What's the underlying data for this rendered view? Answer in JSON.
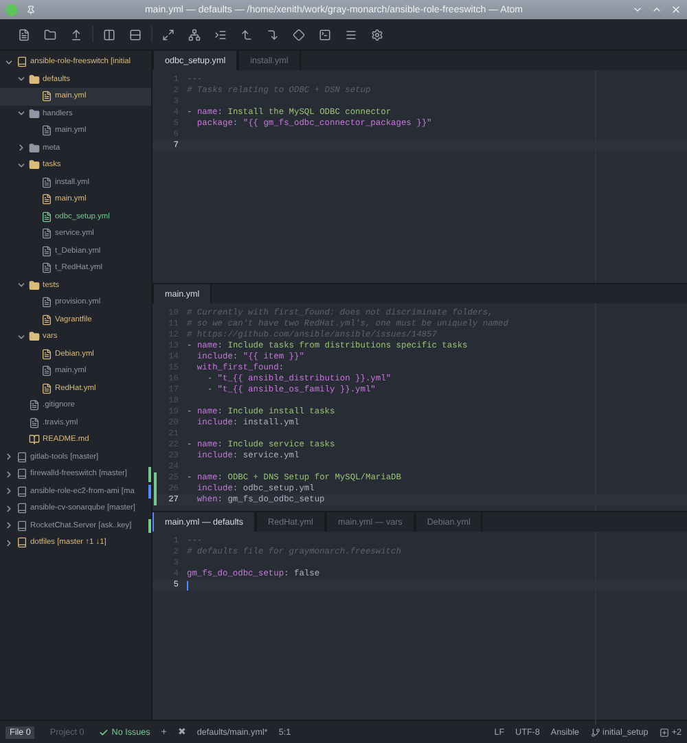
{
  "window": {
    "title": "main.yml — defaults — /home/xenith/work/gray-monarch/ansible-role-freeswitch — Atom"
  },
  "sidebar": {
    "tree": [
      {
        "kind": "repo",
        "label": "ansible-role-freeswitch [initial",
        "modified": true,
        "untracked": false,
        "expanded": true,
        "selected": false,
        "children": [
          {
            "kind": "folder",
            "label": "defaults",
            "modified": true,
            "untracked": false,
            "expanded": true,
            "selected": false,
            "children": [
              {
                "kind": "file",
                "label": "main.yml",
                "modified": true,
                "untracked": false,
                "selected": true
              }
            ]
          },
          {
            "kind": "folder",
            "label": "handlers",
            "modified": false,
            "untracked": false,
            "expanded": true,
            "selected": false,
            "children": [
              {
                "kind": "file",
                "label": "main.yml",
                "modified": false,
                "untracked": false,
                "selected": false
              }
            ]
          },
          {
            "kind": "folder",
            "label": "meta",
            "modified": false,
            "untracked": false,
            "expanded": false,
            "selected": false
          },
          {
            "kind": "folder",
            "label": "tasks",
            "modified": true,
            "untracked": false,
            "expanded": true,
            "selected": false,
            "children": [
              {
                "kind": "file",
                "label": "install.yml",
                "modified": false,
                "untracked": false,
                "selected": false
              },
              {
                "kind": "file",
                "label": "main.yml",
                "modified": true,
                "untracked": false,
                "selected": false
              },
              {
                "kind": "file",
                "label": "odbc_setup.yml",
                "modified": false,
                "untracked": true,
                "selected": false
              },
              {
                "kind": "file",
                "label": "service.yml",
                "modified": false,
                "untracked": false,
                "selected": false
              },
              {
                "kind": "file",
                "label": "t_Debian.yml",
                "modified": false,
                "untracked": false,
                "selected": false
              },
              {
                "kind": "file",
                "label": "t_RedHat.yml",
                "modified": false,
                "untracked": false,
                "selected": false
              }
            ]
          },
          {
            "kind": "folder",
            "label": "tests",
            "modified": true,
            "untracked": false,
            "expanded": true,
            "selected": false,
            "children": [
              {
                "kind": "file",
                "label": "provision.yml",
                "modified": false,
                "untracked": false,
                "selected": false
              },
              {
                "kind": "file",
                "label": "Vagrantfile",
                "modified": true,
                "untracked": false,
                "selected": false
              }
            ]
          },
          {
            "kind": "folder",
            "label": "vars",
            "modified": true,
            "untracked": false,
            "expanded": true,
            "selected": false,
            "children": [
              {
                "kind": "file",
                "label": "Debian.yml",
                "modified": true,
                "untracked": false,
                "selected": false
              },
              {
                "kind": "file",
                "label": "main.yml",
                "modified": false,
                "untracked": false,
                "selected": false
              },
              {
                "kind": "file",
                "label": "RedHat.yml",
                "modified": true,
                "untracked": false,
                "selected": false
              }
            ]
          },
          {
            "kind": "file",
            "label": ".gitignore",
            "modified": false,
            "untracked": false,
            "selected": false
          },
          {
            "kind": "file",
            "label": ".travis.yml",
            "modified": false,
            "untracked": false,
            "selected": false
          },
          {
            "kind": "readme",
            "label": "README.md",
            "modified": true,
            "untracked": false,
            "selected": false
          }
        ]
      },
      {
        "kind": "repo",
        "label": "gitlab-tools [master]",
        "modified": false,
        "untracked": false,
        "expanded": false,
        "selected": false
      },
      {
        "kind": "repo",
        "label": "firewalld-freeswitch [master]",
        "modified": false,
        "untracked": false,
        "expanded": false,
        "selected": false,
        "color": "#73c990"
      },
      {
        "kind": "repo",
        "label": "ansible-role-ec2-from-ami [ma",
        "modified": false,
        "untracked": false,
        "expanded": false,
        "selected": false,
        "color": "#568af2"
      },
      {
        "kind": "repo",
        "label": "ansible-cv-sonarqube [master]",
        "modified": false,
        "untracked": false,
        "expanded": false,
        "selected": false
      },
      {
        "kind": "repo",
        "label": "RocketChat.Server [ask..key]",
        "modified": false,
        "untracked": false,
        "expanded": false,
        "selected": false,
        "color": "#73c990"
      },
      {
        "kind": "repo",
        "label": "dotfiles [master ↑1 ↓1]",
        "modified": true,
        "untracked": false,
        "expanded": false,
        "selected": false
      }
    ]
  },
  "panes": [
    {
      "focused": false,
      "tabs": [
        {
          "label": "odbc_setup.yml",
          "selected": true
        },
        {
          "label": "install.yml",
          "selected": false
        }
      ],
      "lines": [
        {
          "number": "1",
          "cursor": false,
          "added": false,
          "tokens": [
            {
              "kind": "comment",
              "text": "---"
            }
          ]
        },
        {
          "number": "2",
          "cursor": false,
          "added": false,
          "tokens": [
            {
              "kind": "comment",
              "text": "# Tasks relating to ODBC + DSN setup"
            }
          ]
        },
        {
          "number": "3",
          "cursor": false,
          "added": false
        },
        {
          "number": "4",
          "cursor": false,
          "added": false,
          "tokens": [
            {
              "kind": "punct",
              "text": "- "
            },
            {
              "kind": "key",
              "text": "name"
            },
            {
              "kind": "punct",
              "text": ": "
            },
            {
              "kind": "string",
              "text": "Install the MySQL ODBC connector"
            }
          ]
        },
        {
          "number": "5",
          "cursor": false,
          "added": false,
          "tokens": [
            {
              "kind": "key",
              "text": "  package"
            },
            {
              "kind": "punct",
              "text": ": "
            },
            {
              "kind": "template",
              "text": "\"{{ gm_fs_odbc_connector_packages }}\""
            }
          ]
        },
        {
          "number": "6",
          "cursor": false,
          "added": false
        },
        {
          "number": "7",
          "cursor": true,
          "added": false
        }
      ]
    },
    {
      "focused": false,
      "tabs": [
        {
          "label": "main.yml",
          "selected": true
        }
      ],
      "lines": [
        {
          "number": "10",
          "cursor": false,
          "added": false,
          "tokens": [
            {
              "kind": "comment",
              "text": "# Currently with first_found: does not discriminate folders,"
            }
          ]
        },
        {
          "number": "11",
          "cursor": false,
          "added": false,
          "tokens": [
            {
              "kind": "comment",
              "text": "# so we can't have two RedHat.yml's, one must be uniquely named"
            }
          ]
        },
        {
          "number": "12",
          "cursor": false,
          "added": false,
          "tokens": [
            {
              "kind": "comment",
              "text": "# https://github.com/ansible/ansible/issues/14857"
            }
          ]
        },
        {
          "number": "13",
          "cursor": false,
          "added": false,
          "tokens": [
            {
              "kind": "punct",
              "text": "- "
            },
            {
              "kind": "key",
              "text": "name"
            },
            {
              "kind": "punct",
              "text": ": "
            },
            {
              "kind": "string",
              "text": "Include tasks from distributions specific tasks"
            }
          ]
        },
        {
          "number": "14",
          "cursor": false,
          "added": false,
          "tokens": [
            {
              "kind": "key",
              "text": "  include"
            },
            {
              "kind": "punct",
              "text": ": "
            },
            {
              "kind": "template",
              "text": "\"{{ item }}\""
            }
          ]
        },
        {
          "number": "15",
          "cursor": false,
          "added": false,
          "tokens": [
            {
              "kind": "key",
              "text": "  with_first_found"
            },
            {
              "kind": "punct",
              "text": ":"
            }
          ]
        },
        {
          "number": "16",
          "cursor": false,
          "added": false,
          "tokens": [
            {
              "kind": "punct",
              "text": "    - "
            },
            {
              "kind": "template",
              "text": "\"t_{{ ansible_distribution }}.yml\""
            }
          ]
        },
        {
          "number": "17",
          "cursor": false,
          "added": false,
          "tokens": [
            {
              "kind": "punct",
              "text": "    - "
            },
            {
              "kind": "template",
              "text": "\"t_{{ ansible_os_family }}.yml\""
            }
          ]
        },
        {
          "number": "18",
          "cursor": false,
          "added": false
        },
        {
          "number": "19",
          "cursor": false,
          "added": false,
          "tokens": [
            {
              "kind": "punct",
              "text": "- "
            },
            {
              "kind": "key",
              "text": "name"
            },
            {
              "kind": "punct",
              "text": ": "
            },
            {
              "kind": "string",
              "text": "Include install tasks"
            }
          ]
        },
        {
          "number": "20",
          "cursor": false,
          "added": false,
          "tokens": [
            {
              "kind": "key",
              "text": "  include"
            },
            {
              "kind": "punct",
              "text": ": "
            },
            {
              "kind": "plain",
              "text": "install.yml"
            }
          ]
        },
        {
          "number": "21",
          "cursor": false,
          "added": false
        },
        {
          "number": "22",
          "cursor": false,
          "added": false,
          "tokens": [
            {
              "kind": "punct",
              "text": "- "
            },
            {
              "kind": "key",
              "text": "name"
            },
            {
              "kind": "punct",
              "text": ": "
            },
            {
              "kind": "string",
              "text": "Include service tasks"
            }
          ]
        },
        {
          "number": "23",
          "cursor": false,
          "added": false,
          "tokens": [
            {
              "kind": "key",
              "text": "  include"
            },
            {
              "kind": "punct",
              "text": ": "
            },
            {
              "kind": "plain",
              "text": "service.yml"
            }
          ]
        },
        {
          "number": "24",
          "cursor": false,
          "added": false
        },
        {
          "number": "25",
          "cursor": false,
          "added": true,
          "tokens": [
            {
              "kind": "punct",
              "text": "- "
            },
            {
              "kind": "key",
              "text": "name"
            },
            {
              "kind": "punct",
              "text": ": "
            },
            {
              "kind": "string",
              "text": "ODBC + DNS Setup for MySQL/MariaDB"
            }
          ]
        },
        {
          "number": "26",
          "cursor": false,
          "added": true,
          "tokens": [
            {
              "kind": "key",
              "text": "  include"
            },
            {
              "kind": "punct",
              "text": ": "
            },
            {
              "kind": "plain",
              "text": "odbc_setup.yml"
            }
          ]
        },
        {
          "number": "27",
          "cursor": true,
          "added": true,
          "tokens": [
            {
              "kind": "key",
              "text": "  when"
            },
            {
              "kind": "punct",
              "text": ": "
            },
            {
              "kind": "plain",
              "text": "gm_fs_do_odbc_setup"
            }
          ]
        }
      ]
    },
    {
      "focused": true,
      "tabs": [
        {
          "label": "main.yml — defaults",
          "selected": true
        },
        {
          "label": "RedHat.yml",
          "selected": false
        },
        {
          "label": "main.yml — vars",
          "selected": false
        },
        {
          "label": "Debian.yml",
          "selected": false
        }
      ],
      "lines": [
        {
          "number": "1",
          "cursor": false,
          "added": false,
          "tokens": [
            {
              "kind": "comment",
              "text": "---"
            }
          ]
        },
        {
          "number": "2",
          "cursor": false,
          "added": false,
          "tokens": [
            {
              "kind": "comment",
              "text": "# defaults file for graymonarch.freeswitch"
            }
          ]
        },
        {
          "number": "3",
          "cursor": false,
          "added": false
        },
        {
          "number": "4",
          "cursor": false,
          "added": false,
          "tokens": [
            {
              "kind": "key",
              "text": "gm_fs_do_odbc_setup"
            },
            {
              "kind": "punct",
              "text": ": "
            },
            {
              "kind": "plain",
              "text": "false"
            }
          ]
        },
        {
          "number": "5",
          "cursor": true,
          "added": false
        }
      ]
    }
  ],
  "status_bar": {
    "left": [
      {
        "kind": "tab",
        "label": "File 0",
        "selected": true
      },
      {
        "kind": "tab",
        "label": "Project 0",
        "selected": false
      },
      {
        "kind": "lint",
        "label": "No Issues"
      },
      {
        "kind": "glyph",
        "label": "+"
      },
      {
        "kind": "glyph",
        "label": "✖"
      },
      {
        "kind": "text",
        "label": "defaults/main.yml*"
      },
      {
        "kind": "text",
        "label": "5:1"
      }
    ],
    "right": [
      {
        "kind": "text",
        "label": "LF"
      },
      {
        "kind": "text",
        "label": "UTF-8"
      },
      {
        "kind": "text",
        "label": "Ansible"
      },
      {
        "kind": "branch",
        "label": "initial_setup"
      },
      {
        "kind": "updates",
        "label": "+2"
      }
    ]
  }
}
